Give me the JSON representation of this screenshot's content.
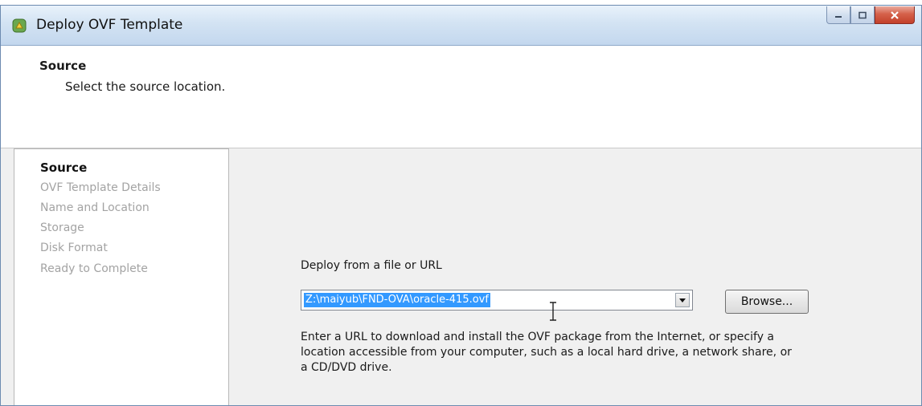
{
  "window": {
    "title": "Deploy OVF Template"
  },
  "header": {
    "title": "Source",
    "subtitle": "Select the source location."
  },
  "steps": [
    {
      "label": "Source",
      "active": true
    },
    {
      "label": "OVF Template Details",
      "active": false
    },
    {
      "label": "Name and Location",
      "active": false
    },
    {
      "label": "Storage",
      "active": false
    },
    {
      "label": "Disk Format",
      "active": false
    },
    {
      "label": "Ready to Complete",
      "active": false
    }
  ],
  "source": {
    "label": "Deploy from a file or URL",
    "path_value": "Z:\\maiyub\\FND-OVA\\oracle-415.ovf",
    "browse_label": "Browse...",
    "help_text": "Enter a URL to download and install the OVF package from the Internet, or specify a location accessible from your computer, such as a local hard drive, a network share, or a CD/DVD drive."
  },
  "icons": {
    "app": "vsphere-app-icon",
    "minimize": "minimize-icon",
    "maximize": "maximize-icon",
    "close": "close-icon",
    "dropdown": "chevron-down-icon",
    "cursor": "text-cursor-icon"
  },
  "colors": {
    "selection": "#3399ff",
    "close_button": "#c3402a"
  }
}
